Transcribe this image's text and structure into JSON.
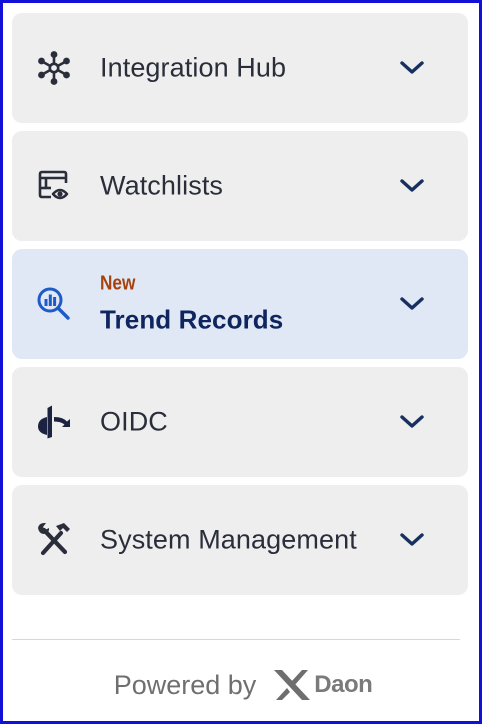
{
  "menu": {
    "items": [
      {
        "label": "Integration Hub",
        "icon": "network-hub-icon",
        "badge": ""
      },
      {
        "label": "Watchlists",
        "icon": "watchlist-eye-icon",
        "badge": ""
      },
      {
        "label": "Trend Records",
        "icon": "chart-search-icon",
        "badge": "New",
        "active": true
      },
      {
        "label": "OIDC",
        "icon": "openid-icon",
        "badge": ""
      },
      {
        "label": "System Management",
        "icon": "tools-icon",
        "badge": ""
      }
    ]
  },
  "footer": {
    "powered_by": "Powered by",
    "brand": "Daon"
  },
  "colors": {
    "border": "#1010d8",
    "item_bg": "#eeeeee",
    "active_bg": "#e1e8f5",
    "active_text": "#0f2560",
    "badge": "#a8420c",
    "divider": "#f2d98c"
  }
}
